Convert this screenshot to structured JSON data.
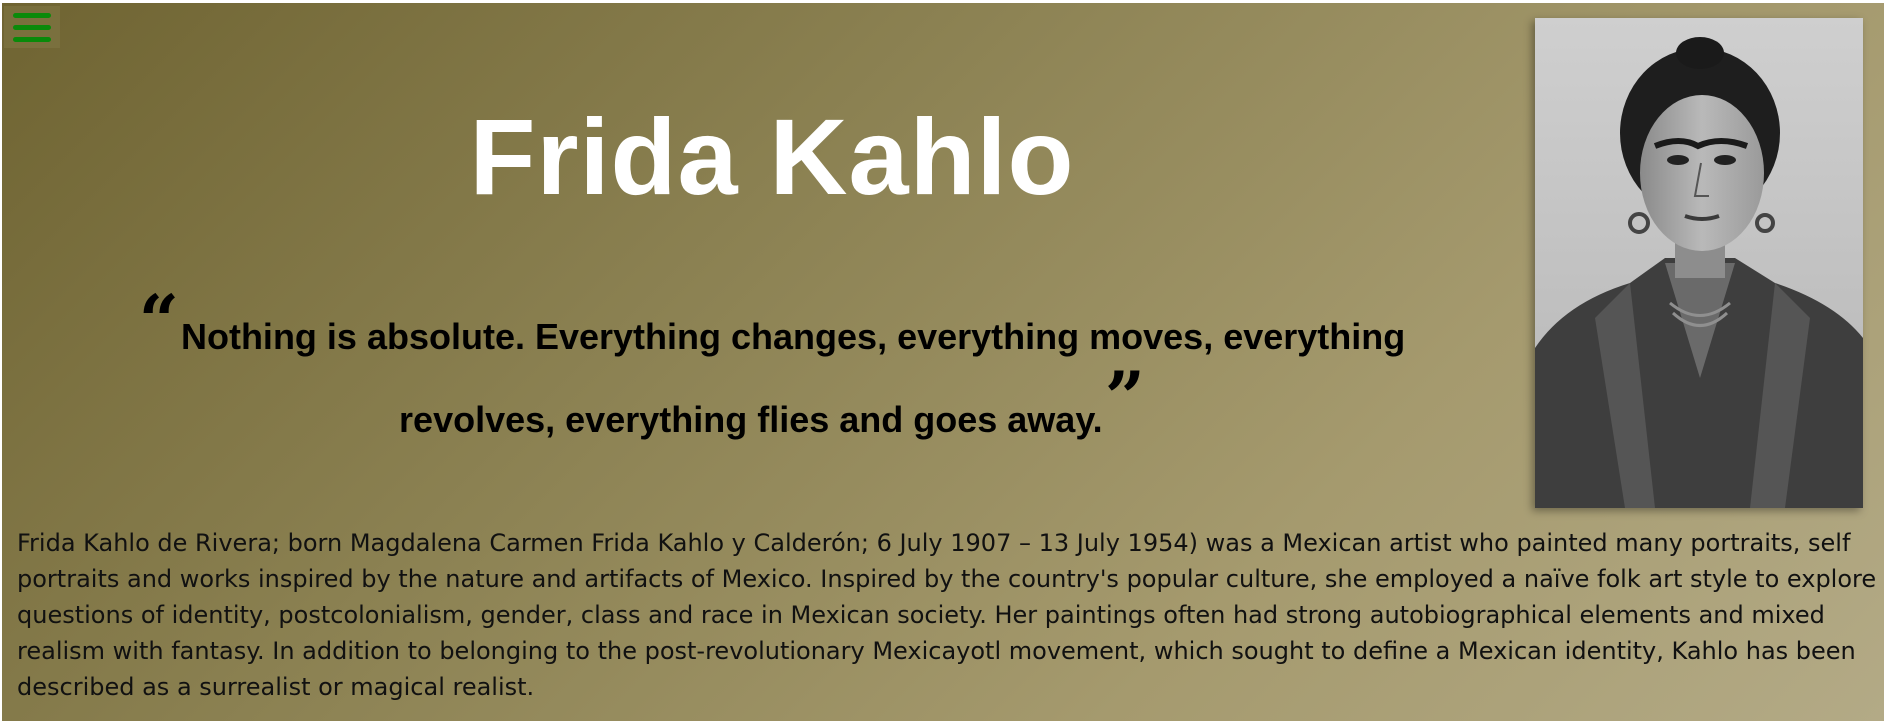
{
  "menu": {
    "icon": "hamburger-menu-icon",
    "color": "#0a8a0a"
  },
  "header": {
    "title": "Frida Kahlo"
  },
  "quote": {
    "text": "Nothing is absolute. Everything changes, everything moves, everything revolves, everything flies and goes away.",
    "open_mark": "“",
    "close_mark": "”"
  },
  "portrait": {
    "description_icon": "portrait-photo",
    "style": "black-and-white"
  },
  "bio": {
    "text": "Frida Kahlo de Rivera; born Magdalena Carmen Frida Kahlo y Calderón; 6 July 1907 – 13 July 1954) was a Mexican artist who painted many portraits, self portraits and works inspired by the nature and artifacts of Mexico. Inspired by the country's popular culture, she employed a naïve folk art style to explore questions of identity, postcolonialism, gender, class and race in Mexican society. Her paintings often had strong autobiographical elements and mixed realism with fantasy. In addition to belonging to the post-revolutionary Mexicayotl movement, which sought to define a Mexican identity, Kahlo has been described as a surrealist or magical realist."
  },
  "colors": {
    "title": "#ffffff",
    "background_start": "#6f6432",
    "background_end": "#b3aa86"
  }
}
